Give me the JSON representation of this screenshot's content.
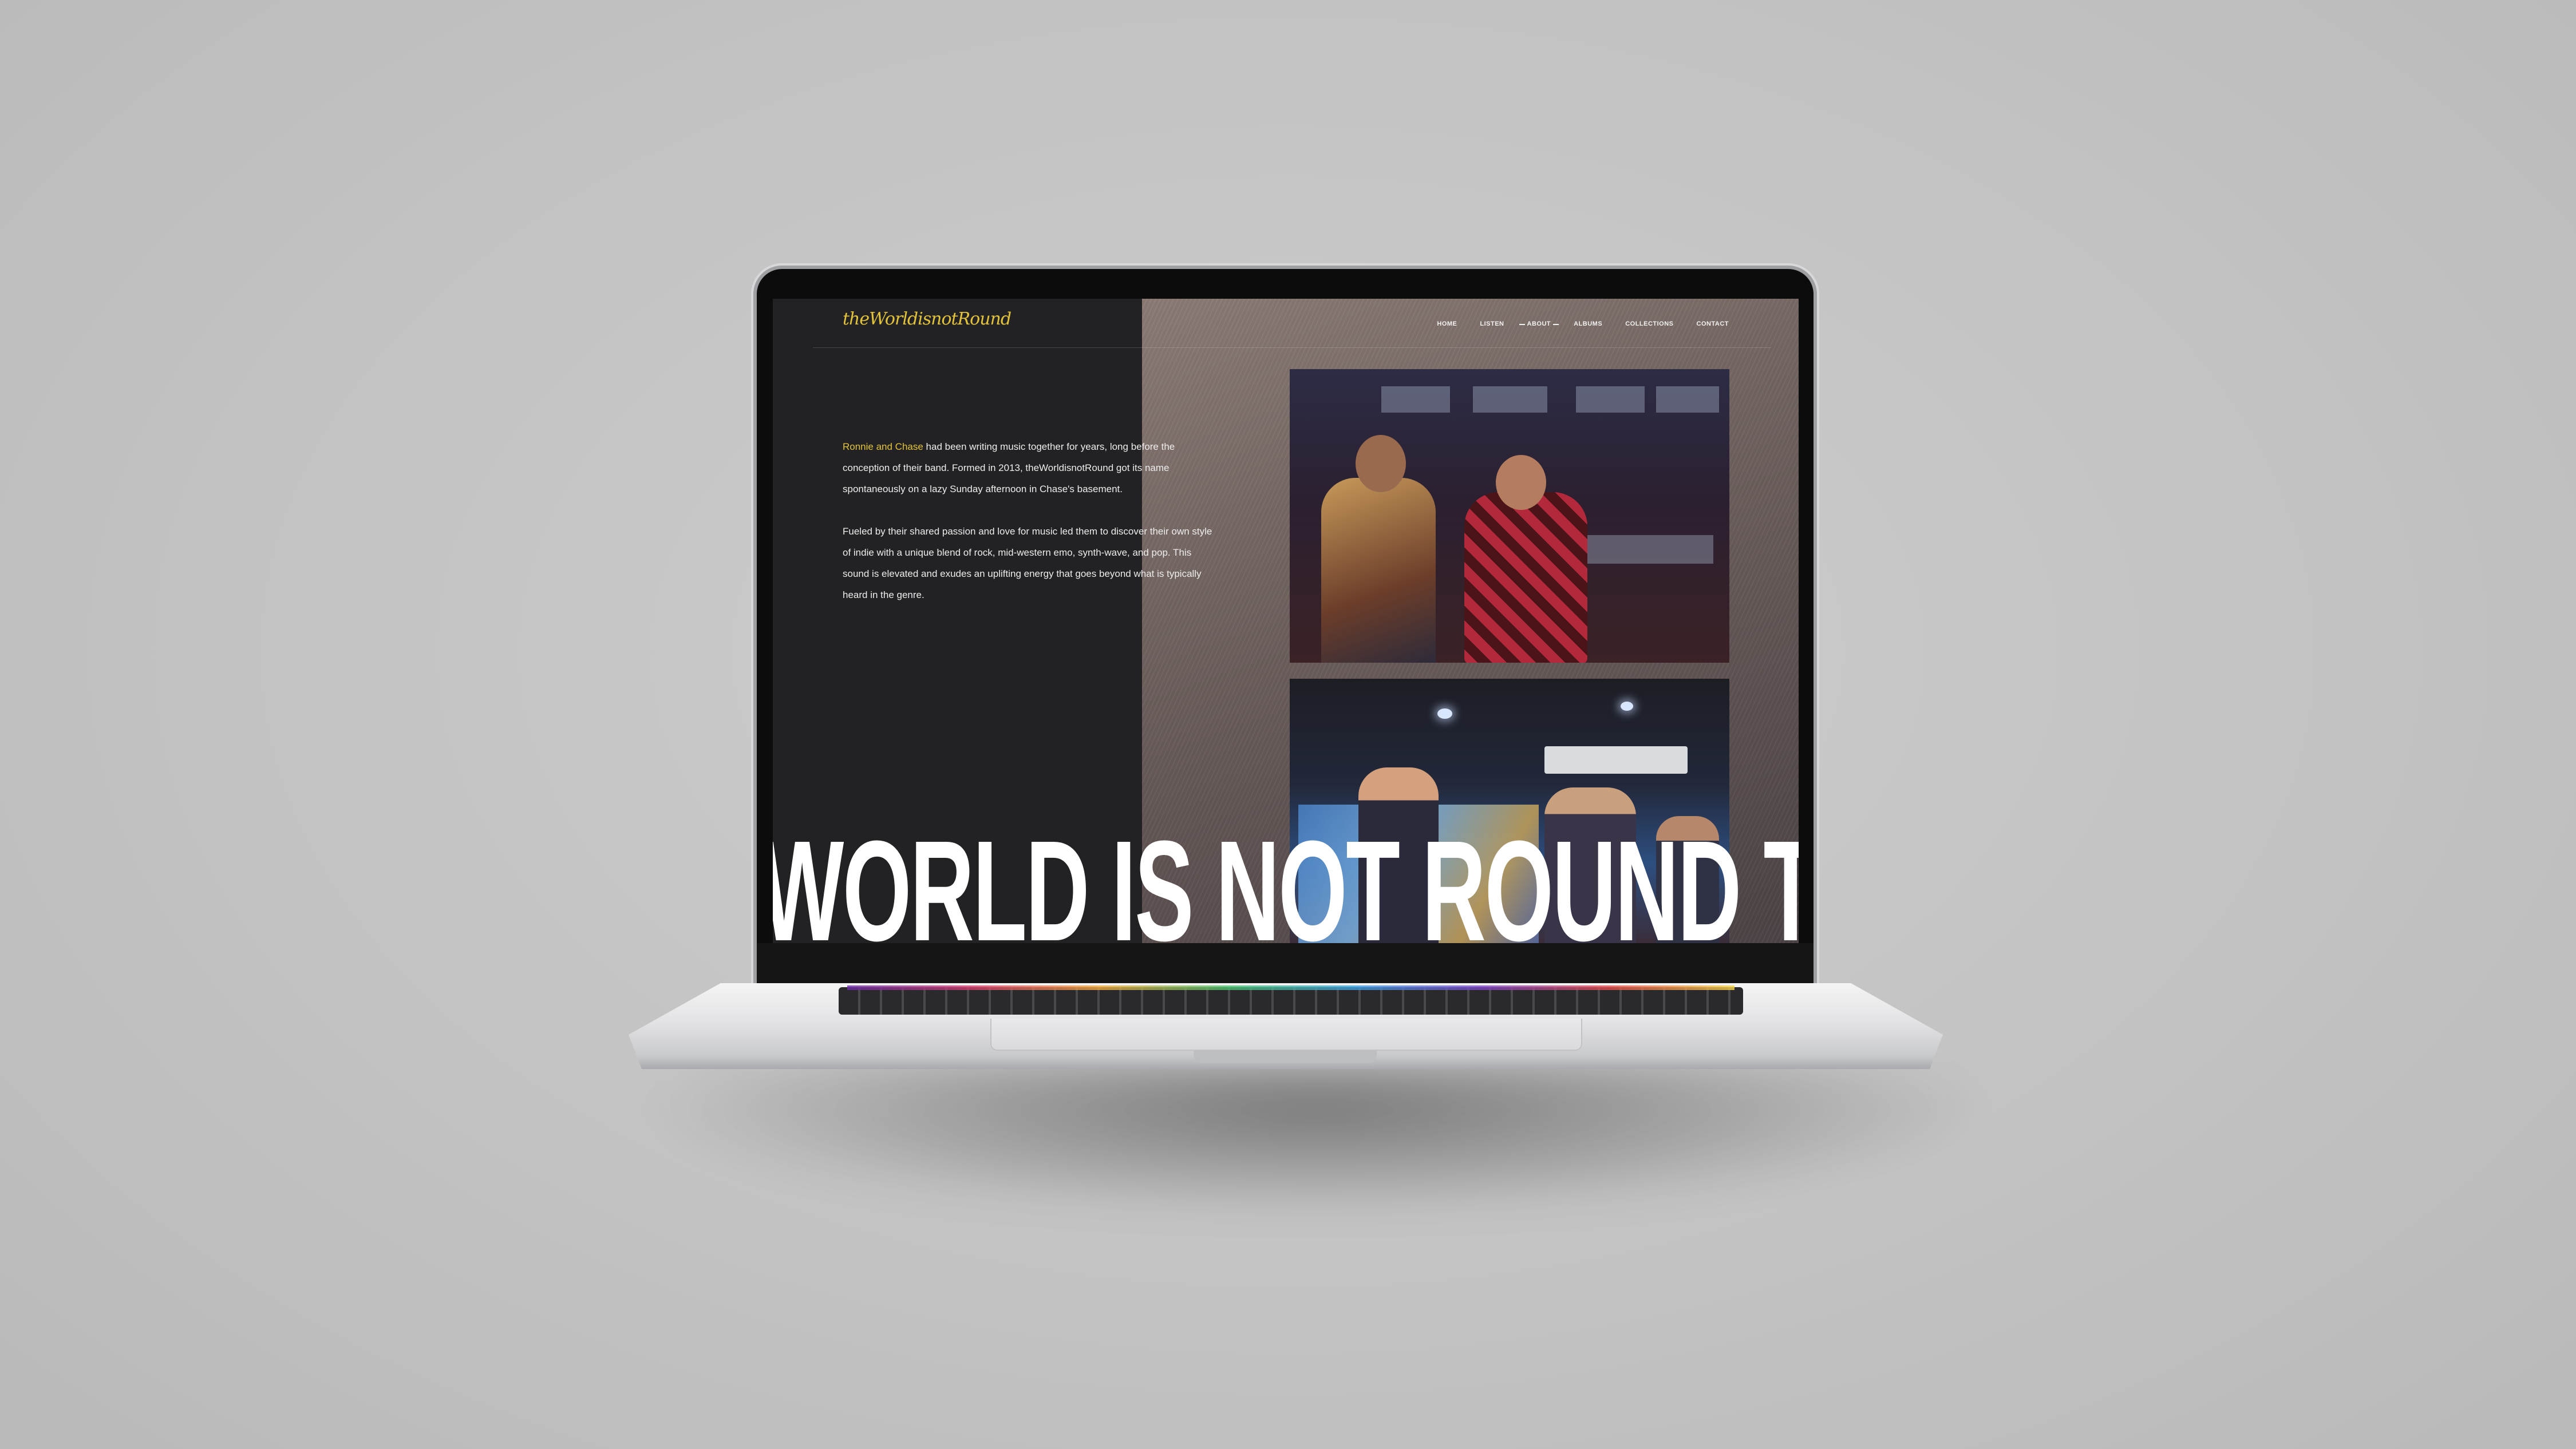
{
  "site": {
    "logo_text": "theWorldisnotRound",
    "accent_color": "#e3c33a"
  },
  "nav": {
    "items": [
      {
        "label": "HOME",
        "active": false
      },
      {
        "label": "LISTEN",
        "active": false
      },
      {
        "label": "ABOUT",
        "active": true
      },
      {
        "label": "ALBUMS",
        "active": false
      },
      {
        "label": "COLLECTIONS",
        "active": false
      },
      {
        "label": "CONTACT",
        "active": false
      }
    ]
  },
  "about": {
    "p1_highlight": "Ronnie and Chase",
    "p1_rest": " had been writing music together for years, long before the conception of their band. Formed in 2013, theWorldisnotRound got its name spontaneously on a lazy Sunday afternoon in Chase's basement.",
    "p2": "Fueled by their shared passion and love for music led them to discover their own style of indie with a unique blend of rock, mid-western emo, synth-wave, and pop. This sound is elevated and exudes an uplifting energy that goes beyond what is typically heard in the genre."
  },
  "marquee": {
    "text": "WORLD IS NOT ROUND THE"
  }
}
